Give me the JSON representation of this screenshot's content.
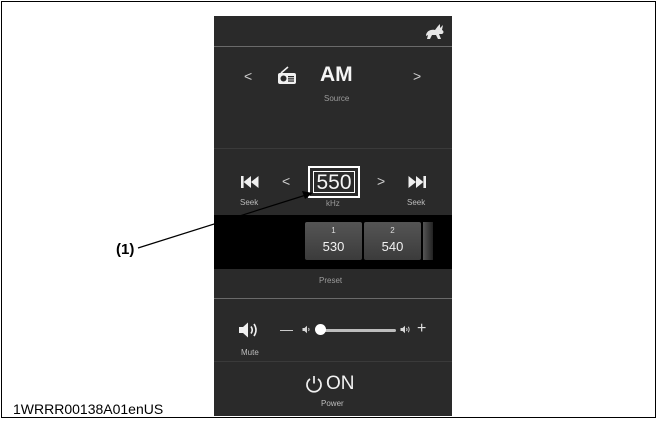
{
  "source": {
    "label": "AM",
    "caption": "Source",
    "prev": "<",
    "next": ">"
  },
  "tuner": {
    "frequency": "550",
    "unit": "kHz",
    "prev": "<",
    "next": ">",
    "seek_back_label": "Seek",
    "seek_fwd_label": "Seek"
  },
  "presets": {
    "items": [
      {
        "number": "1",
        "value": "530"
      },
      {
        "number": "2",
        "value": "540"
      }
    ],
    "caption": "Preset"
  },
  "volume": {
    "mute_label": "Mute",
    "minus": "—",
    "plus": "+",
    "level": 0.05
  },
  "power": {
    "label": "ON",
    "caption": "Power"
  },
  "callout": "(1)",
  "footnote": "1WRRR00138A01enUS",
  "icons": [
    "rabbit-icon",
    "radio-icon",
    "skip-back-icon",
    "skip-forward-icon",
    "speaker-icon",
    "volume-low-icon",
    "volume-high-icon",
    "power-icon"
  ],
  "colors": {
    "panel": "#2a2a2a",
    "strip": "#000000",
    "text": "#eaeaea"
  }
}
